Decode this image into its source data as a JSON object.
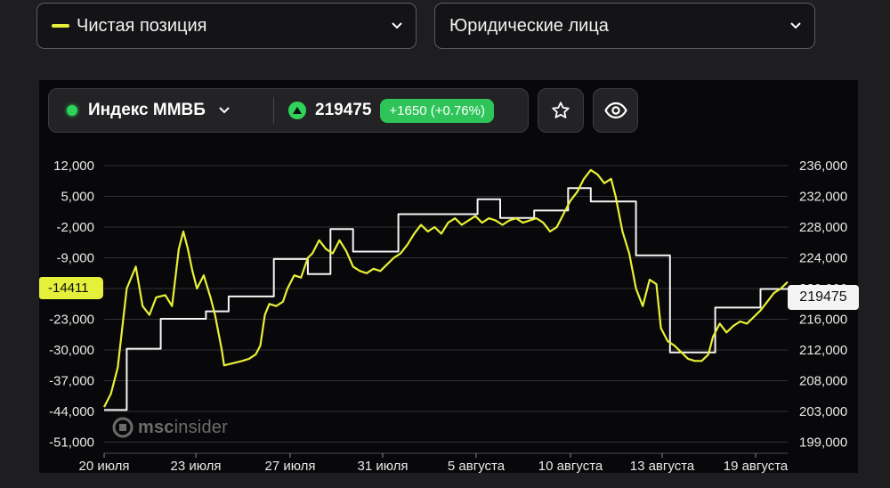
{
  "filters": {
    "left": {
      "label": "Чистая позиция",
      "legend_color": "#e4f03a"
    },
    "right": {
      "label": "Юридические лица"
    }
  },
  "instrument": {
    "name": "Индекс ММВБ",
    "status_color": "#2fd35a",
    "price": "219475",
    "change": "+1650 (+0.76%)",
    "change_color": "#2fc45a"
  },
  "icons": {
    "dropdown": "chevron-down-icon",
    "favorite": "star-icon",
    "visibility": "eye-icon",
    "trend": "triangle-up-icon"
  },
  "watermark": {
    "logo": "mscinsider-logo",
    "text_bold": "msc",
    "text_light": "insider"
  },
  "chart_data": {
    "type": "line",
    "x_tick_labels": [
      "20 июля",
      "23 июля",
      "27 июля",
      "31 июля",
      "5 августа",
      "10 августа",
      "13 августа",
      "19 августа"
    ],
    "x_range": [
      0,
      22
    ],
    "y_left": {
      "ticks": [
        "12,000",
        "5,000",
        "-2,000",
        "-9,000",
        "-16,000",
        "-23,000",
        "-30,000",
        "-37,000",
        "-44,000",
        "-51,000"
      ],
      "range": [
        -51000,
        12000
      ],
      "current_label": "-14411"
    },
    "y_right": {
      "ticks": [
        "236,000",
        "232,000",
        "228,000",
        "224,000",
        "220,000",
        "216,000",
        "212,000",
        "208,000",
        "203,000",
        "199,000"
      ],
      "range": [
        199000,
        236000
      ],
      "current_label": "219475"
    },
    "grid": true,
    "series": [
      {
        "axis": "left",
        "color": "#e8f038",
        "points": [
          [
            0,
            -43000
          ],
          [
            0.3,
            -40000
          ],
          [
            0.6,
            -34000
          ],
          [
            1.0,
            -16000
          ],
          [
            1.4,
            -11000
          ],
          [
            1.7,
            -20000
          ],
          [
            2.0,
            -22000
          ],
          [
            2.3,
            -18000
          ],
          [
            2.7,
            -17500
          ],
          [
            3.0,
            -20000
          ],
          [
            3.3,
            -7000
          ],
          [
            3.5,
            -3000
          ],
          [
            3.7,
            -7000
          ],
          [
            3.9,
            -12000
          ],
          [
            4.1,
            -16000
          ],
          [
            4.4,
            -13000
          ],
          [
            4.7,
            -18000
          ],
          [
            4.9,
            -22000
          ],
          [
            5.2,
            -30000
          ],
          [
            5.3,
            -33500
          ],
          [
            5.7,
            -33000
          ],
          [
            6.1,
            -32500
          ],
          [
            6.4,
            -32000
          ],
          [
            6.7,
            -31000
          ],
          [
            6.9,
            -29000
          ],
          [
            7.1,
            -22000
          ],
          [
            7.3,
            -19500
          ],
          [
            7.6,
            -20000
          ],
          [
            7.9,
            -19000
          ],
          [
            8.1,
            -16000
          ],
          [
            8.4,
            -13000
          ],
          [
            8.7,
            -13500
          ],
          [
            9.0,
            -9000
          ],
          [
            9.2,
            -8000
          ],
          [
            9.5,
            -5000
          ],
          [
            9.8,
            -7000
          ],
          [
            10.1,
            -8000
          ],
          [
            10.4,
            -5000
          ],
          [
            10.7,
            -7500
          ],
          [
            11.0,
            -11000
          ],
          [
            11.3,
            -12000
          ],
          [
            11.6,
            -12500
          ],
          [
            11.9,
            -11500
          ],
          [
            12.2,
            -12000
          ],
          [
            12.5,
            -10500
          ],
          [
            12.8,
            -9000
          ],
          [
            13.1,
            -8000
          ],
          [
            13.4,
            -6000
          ],
          [
            13.7,
            -3500
          ],
          [
            14.0,
            -1500
          ],
          [
            14.3,
            -3000
          ],
          [
            14.6,
            -2000
          ],
          [
            14.9,
            -3500
          ],
          [
            15.2,
            -1000
          ],
          [
            15.5,
            0
          ],
          [
            15.8,
            -1500
          ],
          [
            16.1,
            -500
          ],
          [
            16.4,
            500
          ],
          [
            16.7,
            -1000
          ],
          [
            17.0,
            0
          ],
          [
            17.3,
            -500
          ],
          [
            17.6,
            -1500
          ],
          [
            17.9,
            -500
          ],
          [
            18.2,
            0
          ],
          [
            18.5,
            -1000
          ],
          [
            18.8,
            -500
          ],
          [
            19.1,
            0
          ],
          [
            19.4,
            -1000
          ],
          [
            19.7,
            -3000
          ],
          [
            20.0,
            -2000
          ],
          [
            20.3,
            1000
          ],
          [
            20.6,
            4000
          ],
          [
            20.9,
            6000
          ],
          [
            21.2,
            9000
          ],
          [
            21.5,
            11000
          ],
          [
            21.8,
            10000
          ],
          [
            22.1,
            8000
          ],
          [
            22.4,
            9000
          ],
          [
            22.6,
            5000
          ],
          [
            22.9,
            -3000
          ],
          [
            23.2,
            -8000
          ],
          [
            23.5,
            -16000
          ],
          [
            23.8,
            -20000
          ],
          [
            24.1,
            -14000
          ],
          [
            24.4,
            -15000
          ],
          [
            24.6,
            -25000
          ],
          [
            24.9,
            -28000
          ],
          [
            25.2,
            -29000
          ],
          [
            25.5,
            -30500
          ],
          [
            25.8,
            -32000
          ],
          [
            26.1,
            -32500
          ],
          [
            26.4,
            -32500
          ],
          [
            26.7,
            -31000
          ],
          [
            26.9,
            -27000
          ],
          [
            27.2,
            -24000
          ],
          [
            27.5,
            -26000
          ],
          [
            27.8,
            -24500
          ],
          [
            28.1,
            -23500
          ],
          [
            28.4,
            -24000
          ],
          [
            28.7,
            -22500
          ],
          [
            29.0,
            -21000
          ],
          [
            29.3,
            -19000
          ],
          [
            29.6,
            -17000
          ],
          [
            29.9,
            -16000
          ],
          [
            30.2,
            -14500
          ]
        ],
        "x_range": [
          0,
          30.2
        ]
      },
      {
        "axis": "right",
        "color": "#f5f5f5",
        "points": [
          [
            0,
            203300
          ],
          [
            1.0,
            203300
          ],
          [
            1.0,
            211500
          ],
          [
            2.5,
            211500
          ],
          [
            2.5,
            215500
          ],
          [
            4.5,
            215500
          ],
          [
            4.5,
            216500
          ],
          [
            5.5,
            216500
          ],
          [
            5.5,
            218500
          ],
          [
            7.5,
            218500
          ],
          [
            7.5,
            223500
          ],
          [
            9.0,
            223500
          ],
          [
            9.0,
            221500
          ],
          [
            10.0,
            221500
          ],
          [
            10.0,
            227500
          ],
          [
            11.0,
            227500
          ],
          [
            11.0,
            224500
          ],
          [
            13.0,
            224500
          ],
          [
            13.0,
            229500
          ],
          [
            16.5,
            229500
          ],
          [
            16.5,
            231500
          ],
          [
            17.5,
            231500
          ],
          [
            17.5,
            229000
          ],
          [
            19.0,
            229000
          ],
          [
            19.0,
            230000
          ],
          [
            20.5,
            230000
          ],
          [
            20.5,
            233000
          ],
          [
            21.5,
            233000
          ],
          [
            21.5,
            231200
          ],
          [
            23.5,
            231200
          ],
          [
            23.5,
            224000
          ],
          [
            25.0,
            224000
          ],
          [
            25.0,
            211000
          ],
          [
            27.0,
            211000
          ],
          [
            27.0,
            217000
          ],
          [
            28.0,
            217000
          ],
          [
            28.0,
            217000
          ],
          [
            29.0,
            217000
          ],
          [
            29.0,
            219500
          ],
          [
            30.2,
            219500
          ]
        ],
        "x_range": [
          0,
          30.2
        ]
      }
    ]
  }
}
